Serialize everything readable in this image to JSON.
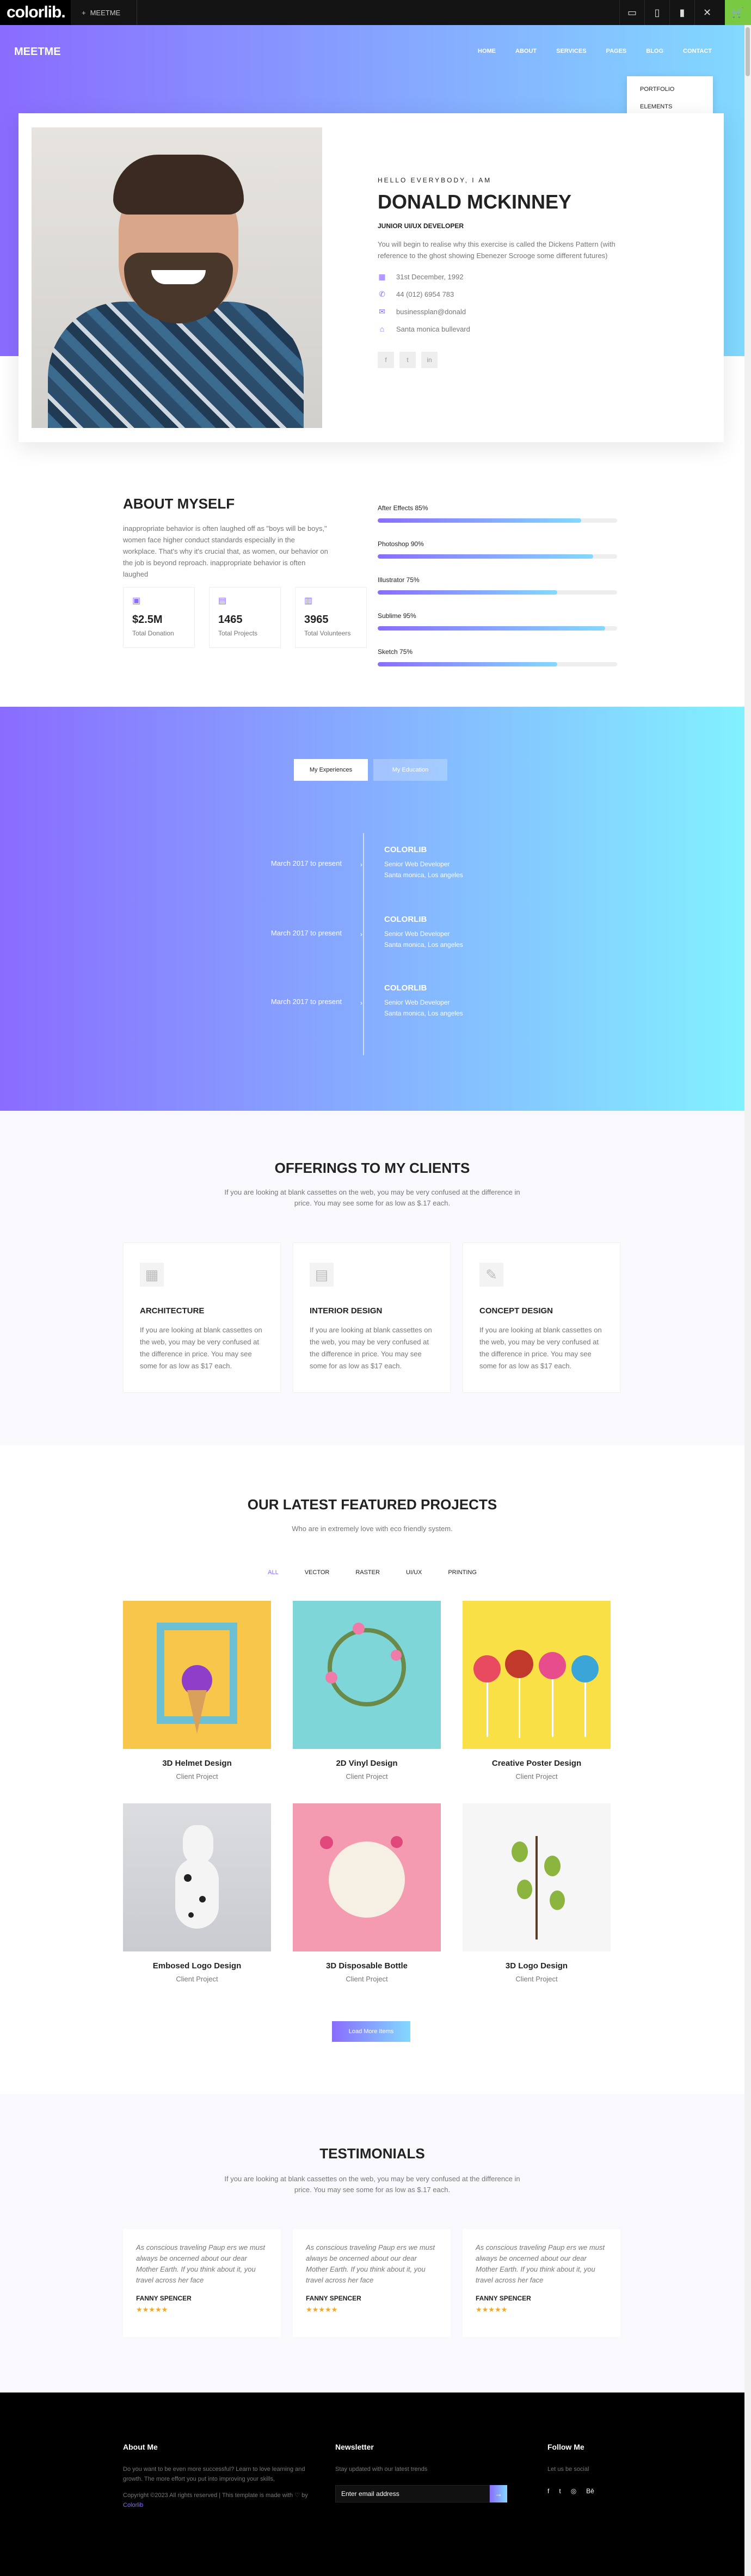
{
  "browser": {
    "logo": "colorlib.",
    "tab_label": "MEETME",
    "tab_icon": "plus-icon",
    "device_icons": [
      "desktop-icon",
      "tablet-icon",
      "mobile-icon",
      "close-icon"
    ],
    "cart_icon": "cart-icon"
  },
  "site": {
    "brand": "MEETME",
    "nav": [
      "HOME",
      "ABOUT",
      "SERVICES",
      "PAGES",
      "BLOG",
      "CONTACT"
    ],
    "dropdown": [
      "PORTFOLIO",
      "ELEMENTS"
    ]
  },
  "hero": {
    "hello": "HELLO EVERYBODY, I AM",
    "name": "DONALD MCKINNEY",
    "role": "JUNIOR UI/UX DEVELOPER",
    "blurb": "You will begin to realise why this exercise is called the Dickens Pattern (with reference to the ghost showing Ebenezer Scrooge some different futures)",
    "contact": [
      {
        "icon": "calendar-icon",
        "text": "31st December, 1992"
      },
      {
        "icon": "phone-icon",
        "text": "44 (012) 6954 783"
      },
      {
        "icon": "mail-icon",
        "text": "businessplan@donald"
      },
      {
        "icon": "home-icon",
        "text": "Santa monica bullevard"
      }
    ],
    "social": [
      "facebook-icon",
      "twitter-icon",
      "linkedin-icon"
    ]
  },
  "about": {
    "title": "ABOUT MYSELF",
    "text": "inappropriate behavior is often laughed off as \"boys will be boys,\" women face higher conduct standards especially in the workplace. That's why it's crucial that, as women, our behavior on the job is beyond reproach. inappropriate behavior is often laughed",
    "stats": [
      {
        "value": "$2.5M",
        "label": "Total Donation"
      },
      {
        "value": "1465",
        "label": "Total Projects"
      },
      {
        "value": "3965",
        "label": "Total Volunteers"
      }
    ],
    "skills": [
      {
        "name": "After Effects 85%",
        "level": 85
      },
      {
        "name": "Photoshop 90%",
        "level": 90
      },
      {
        "name": "Illustrator 75%",
        "level": 75
      },
      {
        "name": "Sublime 95%",
        "level": 95
      },
      {
        "name": "Sketch 75%",
        "level": 75
      }
    ]
  },
  "experience": {
    "tabs": [
      "My Experiences",
      "My Education"
    ],
    "items": [
      {
        "period": "March 2017 to present",
        "company": "COLORLIB",
        "role": "Senior Web Developer",
        "location": "Santa monica, Los angeles"
      },
      {
        "period": "March 2017 to present",
        "company": "COLORLIB",
        "role": "Senior Web Developer",
        "location": "Santa monica, Los angeles"
      },
      {
        "period": "March 2017 to present",
        "company": "COLORLIB",
        "role": "Senior Web Developer",
        "location": "Santa monica, Los angeles"
      }
    ]
  },
  "offerings": {
    "title": "OFFERINGS TO MY CLIENTS",
    "subtitle": "If you are looking at blank cassettes on the web, you may be very confused at the difference in price. You may see some for as low as $.17 each.",
    "items": [
      {
        "name": "ARCHITECTURE",
        "text": "If you are looking at blank cassettes on the web, you may be very confused at the difference in price. You may see some for as low as $17 each."
      },
      {
        "name": "INTERIOR DESIGN",
        "text": "If you are looking at blank cassettes on the web, you may be very confused at the difference in price. You may see some for as low as $17 each."
      },
      {
        "name": "CONCEPT DESIGN",
        "text": "If you are looking at blank cassettes on the web, you may be very confused at the difference in price. You may see some for as low as $17 each."
      }
    ]
  },
  "projects": {
    "title": "OUR LATEST FEATURED PROJECTS",
    "subtitle": "Who are in extremely love with eco friendly system.",
    "filters": [
      "ALL",
      "VECTOR",
      "RASTER",
      "UI/UX",
      "PRINTING"
    ],
    "items": [
      {
        "title": "3D Helmet Design",
        "category": "Client Project"
      },
      {
        "title": "2D Vinyl Design",
        "category": "Client Project"
      },
      {
        "title": "Creative Poster Design",
        "category": "Client Project"
      },
      {
        "title": "Embosed Logo Design",
        "category": "Client Project"
      },
      {
        "title": "3D Disposable Bottle",
        "category": "Client Project"
      },
      {
        "title": "3D Logo Design",
        "category": "Client Project"
      }
    ],
    "load_more": "Load More Items"
  },
  "testimonials": {
    "title": "TESTIMONIALS",
    "subtitle": "If you are looking at blank cassettes on the web, you may be very confused at the difference in price. You may see some for as low as $.17 each.",
    "items": [
      {
        "quote": "As conscious traveling Paup ers we must always be oncerned about our dear Mother Earth. If you think about it, you travel across her face",
        "name": "FANNY SPENCER",
        "rating": 5
      },
      {
        "quote": "As conscious traveling Paup ers we must always be oncerned about our dear Mother Earth. If you think about it, you travel across her face",
        "name": "FANNY SPENCER",
        "rating": 5
      },
      {
        "quote": "As conscious traveling Paup ers we must always be oncerned about our dear Mother Earth. If you think about it, you travel across her face",
        "name": "FANNY SPENCER",
        "rating": 5
      }
    ]
  },
  "footer": {
    "about_title": "About Me",
    "about_text": "Do you want to be even more successful? Learn to love learning and growth. The more effort you put into improving your skills,",
    "copyright": "Copyright ©2023 All rights reserved | This template is made with ♡ by",
    "copyright_link": "Colorlib",
    "newsletter_title": "Newsletter",
    "newsletter_text": "Stay updated with our latest trends",
    "newsletter_placeholder": "Enter email address",
    "follow_title": "Follow Me",
    "follow_text": "Let us be social",
    "social": [
      "facebook-icon",
      "twitter-icon",
      "dribbble-icon",
      "behance-icon"
    ]
  }
}
